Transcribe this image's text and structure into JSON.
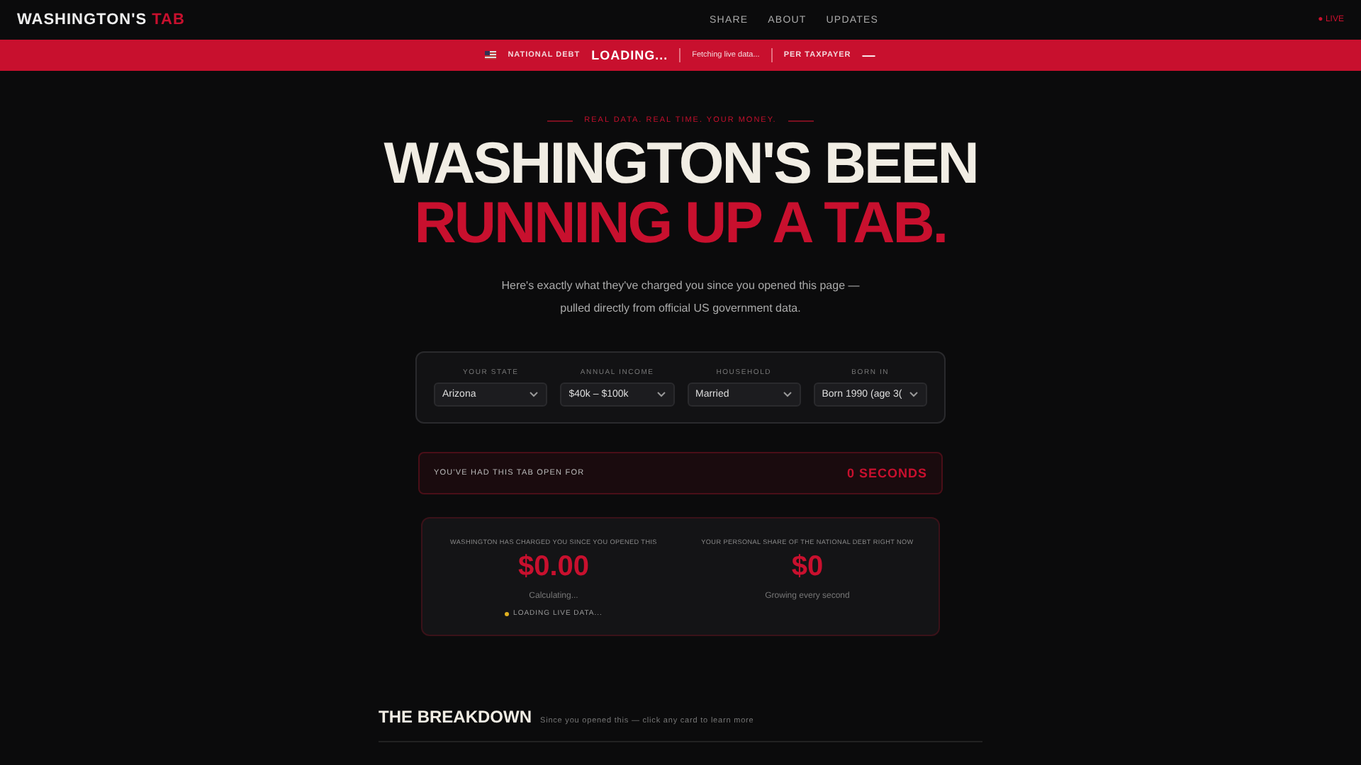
{
  "header": {
    "logo": "WASHINGTON'S",
    "logo_accent": "TAB",
    "nav": [
      "SHARE",
      "ABOUT",
      "UPDATES"
    ],
    "live": "● LIVE"
  },
  "ticker": {
    "label": "NATIONAL DEBT",
    "value": "LOADING...",
    "status": "Fetching live data...",
    "per_label": "PER TAXPAYER",
    "per_value": "—"
  },
  "hero": {
    "kicker": "REAL DATA. REAL TIME. YOUR MONEY.",
    "title_line1": "WASHINGTON'S BEEN",
    "title_line2": "RUNNING UP A TAB.",
    "subtitle_line1": "Here's exactly what they've charged you since you opened this page —",
    "subtitle_line2": "pulled directly from official US government data."
  },
  "filters": [
    {
      "label": "YOUR STATE",
      "value": "Arizona"
    },
    {
      "label": "ANNUAL INCOME",
      "value": "$40k – $100k"
    },
    {
      "label": "HOUSEHOLD",
      "value": "Married"
    },
    {
      "label": "BORN IN",
      "value": "Born 1990 (age 3("
    }
  ],
  "timer": {
    "label": "YOU'VE HAD THIS TAB OPEN FOR",
    "value": "0 SECONDS"
  },
  "charges": [
    {
      "label": "WASHINGTON HAS CHARGED YOU SINCE YOU OPENED THIS",
      "value": "$0.00",
      "note": "Calculating..."
    },
    {
      "label": "YOUR PERSONAL SHARE OF THE NATIONAL DEBT RIGHT NOW",
      "value": "$0",
      "note": "Growing every second"
    }
  ],
  "status": "LOADING LIVE DATA...",
  "breakdown": {
    "title": "THE BREAKDOWN",
    "subtitle": "Since you opened this — click any card to learn more"
  }
}
